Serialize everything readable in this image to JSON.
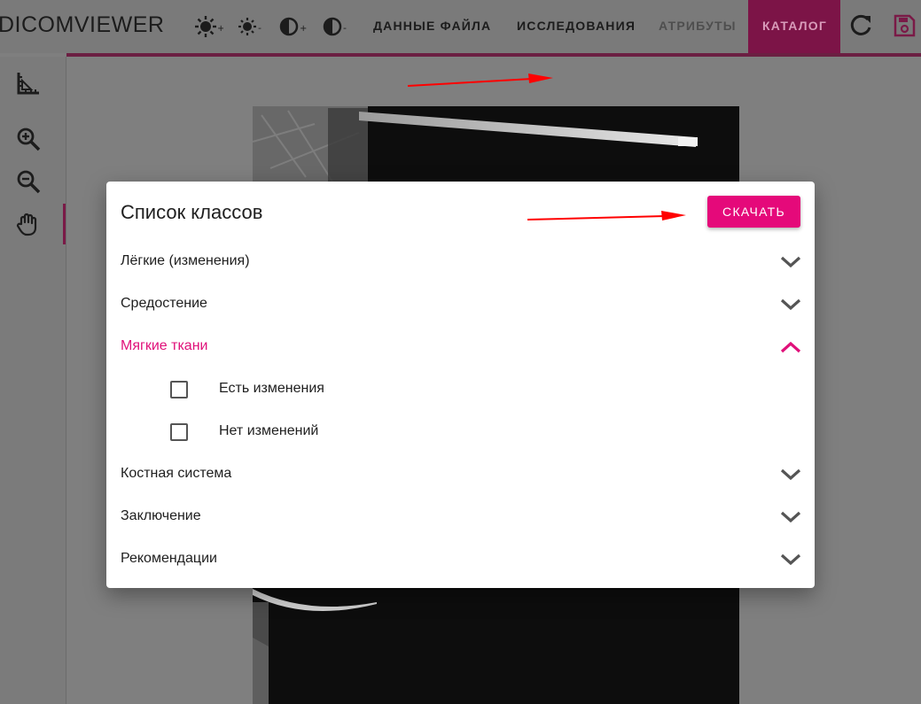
{
  "app": {
    "brand_prefix": "DICOM",
    "brand_suffix": "VIEWER"
  },
  "toolbar": {
    "icons": [
      "brightness-up-icon",
      "brightness-down-icon",
      "contrast-up-icon",
      "contrast-down-icon"
    ],
    "tabs": [
      {
        "label": "ДАННЫЕ ФАЙЛА",
        "state": "normal"
      },
      {
        "label": "ИССЛЕДОВАНИЯ",
        "state": "normal"
      },
      {
        "label": "АТРИБУТЫ",
        "state": "disabled"
      },
      {
        "label": "КАТАЛОГ",
        "state": "active"
      }
    ],
    "actions": [
      "refresh-icon",
      "save-icon"
    ]
  },
  "sidebar": {
    "tools": [
      "ruler-icon",
      "zoom-in-icon",
      "zoom-out-icon",
      "pan-hand-icon"
    ],
    "active_tool": "pan-hand-icon"
  },
  "modal": {
    "title": "Список классов",
    "download_label": "СКАЧАТЬ",
    "sections": [
      {
        "label": "Лёгкие (изменения)",
        "expanded": false
      },
      {
        "label": "Средостение",
        "expanded": false
      },
      {
        "label": "Мягкие ткани",
        "expanded": true,
        "options": [
          {
            "label": "Есть изменения",
            "checked": false
          },
          {
            "label": "Нет изменений",
            "checked": false
          }
        ]
      },
      {
        "label": "Костная система",
        "expanded": false
      },
      {
        "label": "Заключение",
        "expanded": false
      },
      {
        "label": "Рекомендации",
        "expanded": false
      }
    ]
  },
  "colors": {
    "accent": "#e5097a",
    "accent_dark_overlay": "#7c1447",
    "annotation_arrow": "#ff0000"
  }
}
